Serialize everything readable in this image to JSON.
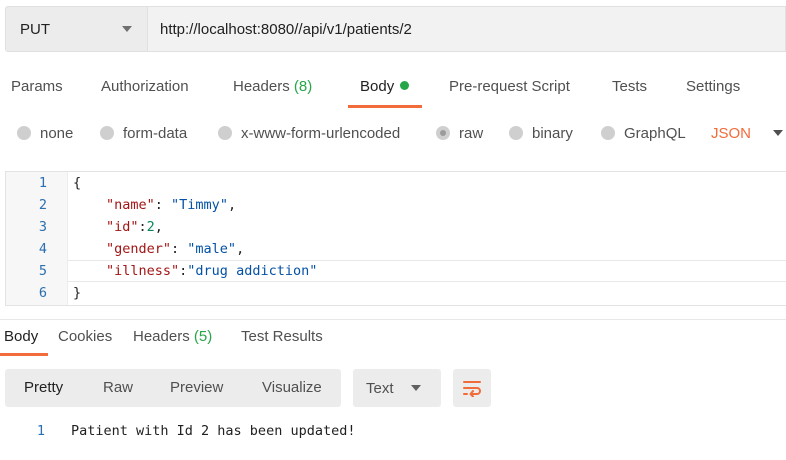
{
  "request": {
    "method": "PUT",
    "url": "http://localhost:8080//api/v1/patients/2"
  },
  "request_tabs": [
    {
      "label": "Params"
    },
    {
      "label": "Authorization"
    },
    {
      "label": "Headers",
      "count": "(8)"
    },
    {
      "label": "Body",
      "active": true,
      "indicator": "dot"
    },
    {
      "label": "Pre-request Script"
    },
    {
      "label": "Tests"
    },
    {
      "label": "Settings"
    }
  ],
  "body_types": {
    "options": [
      "none",
      "form-data",
      "x-www-form-urlencoded",
      "raw",
      "binary",
      "GraphQL"
    ],
    "selected": "raw",
    "format": "JSON"
  },
  "editor": {
    "line_numbers": [
      "1",
      "2",
      "3",
      "4",
      "5",
      "6"
    ],
    "lines": {
      "l1": "{",
      "l2_key": "\"name\"",
      "l2_sep": ": ",
      "l2_val": "\"Timmy\"",
      "l2_end": ",",
      "l3_key": "\"id\"",
      "l3_sep": ":",
      "l3_val": "2",
      "l3_end": ",",
      "l4_key": "\"gender\"",
      "l4_sep": ": ",
      "l4_val": "\"male\"",
      "l4_end": ",",
      "l5_key": "\"illness\"",
      "l5_sep": ":",
      "l5_val": "\"drug addiction\"",
      "l6": "}"
    }
  },
  "response_tabs": [
    {
      "label": "Body",
      "active": true
    },
    {
      "label": "Cookies"
    },
    {
      "label": "Headers",
      "count": "(5)"
    },
    {
      "label": "Test Results"
    }
  ],
  "response_toolbar": {
    "modes": [
      "Pretty",
      "Raw",
      "Preview",
      "Visualize"
    ],
    "active_mode": "Pretty",
    "format": "Text",
    "wrap_icon": "wrap-lines-icon"
  },
  "response_body": {
    "line_number": "1",
    "text": "Patient with Id 2 has been updated!"
  },
  "colors": {
    "accent": "#f26b3a",
    "count_green": "#26a647",
    "line_number_blue": "#2a6fb0",
    "json_key": "#a31515",
    "json_string": "#0451a5",
    "json_number": "#098658"
  }
}
